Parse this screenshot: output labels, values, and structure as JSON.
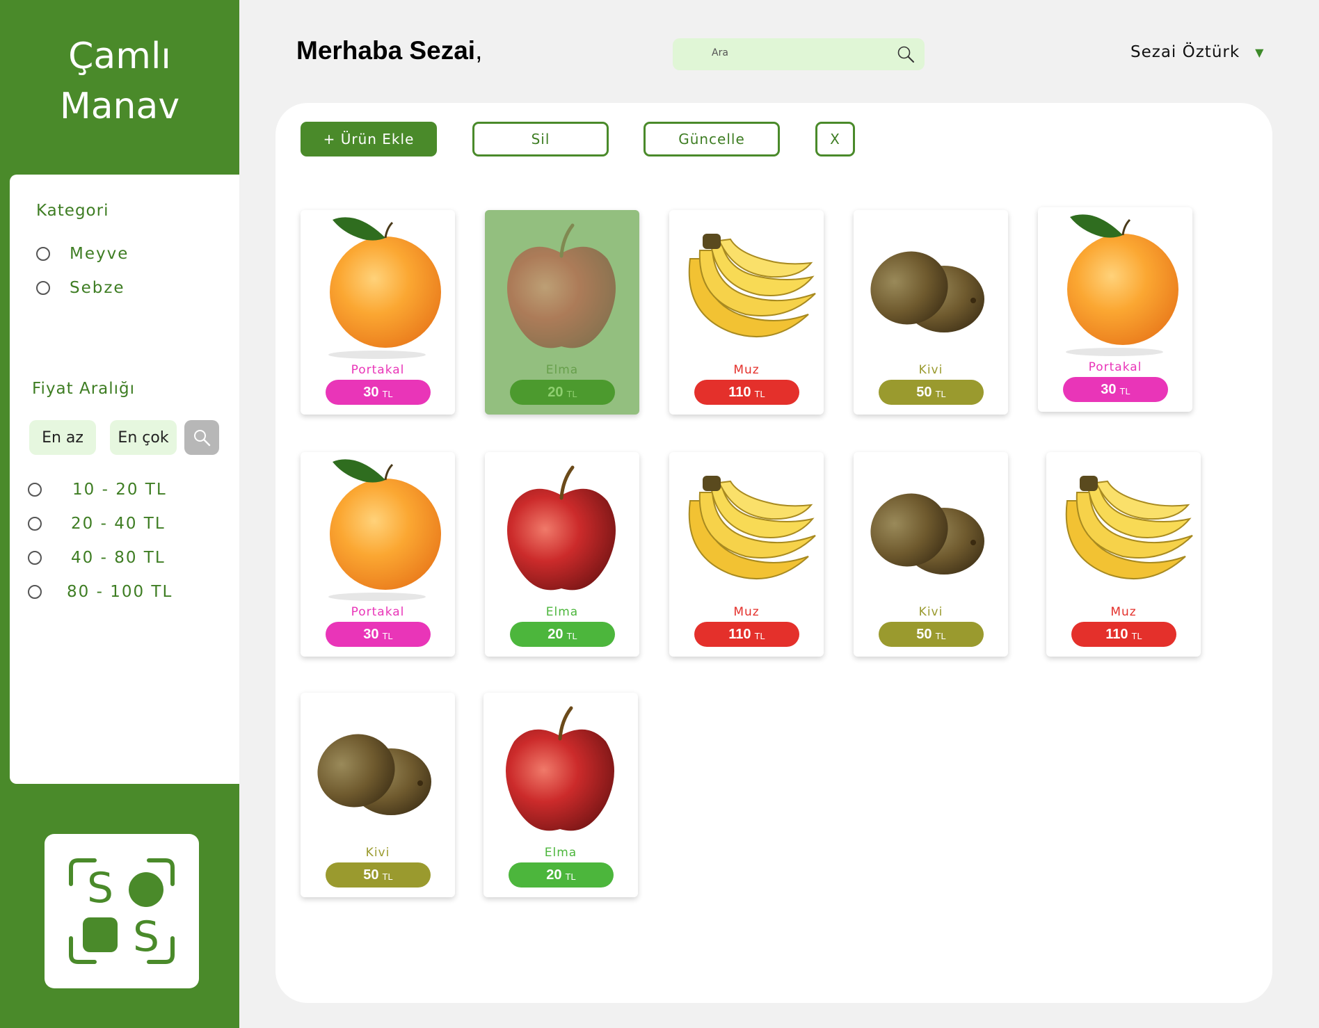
{
  "brand": {
    "line1": "Çamlı",
    "line2": "Manav"
  },
  "filters": {
    "category_title": "Kategori",
    "categories": [
      "Meyve",
      "Sebze"
    ],
    "price_title": "Fiyat Aralığı",
    "min_placeholder": "En az",
    "max_placeholder": "En çok",
    "ranges": [
      "10 - 20 TL",
      "20 - 40 TL",
      "40 - 80 TL",
      "80 - 100 TL"
    ]
  },
  "header": {
    "greeting_name": "Merhaba Sezai",
    "greeting_punct": ",",
    "search_placeholder": "Ara",
    "user_name": "Sezai Öztürk"
  },
  "toolbar": {
    "add_label": "+ Ürün Ekle",
    "delete_label": "Sil",
    "update_label": "Güncelle",
    "close_label": "X"
  },
  "currency": "TL",
  "colors": {
    "brand_green": "#4a8a2a",
    "portakal": "#e935b8",
    "elma": "#4cb63c",
    "muz": "#e4302b",
    "kivi": "#9a9a2e"
  },
  "products": [
    {
      "name": "Portakal",
      "price": "30",
      "fruit": "orange",
      "selected": false
    },
    {
      "name": "Elma",
      "price": "20",
      "fruit": "apple",
      "selected": true
    },
    {
      "name": "Muz",
      "price": "110",
      "fruit": "banana",
      "selected": false
    },
    {
      "name": "Kivi",
      "price": "50",
      "fruit": "kiwi",
      "selected": false
    },
    {
      "name": "Portakal",
      "price": "30",
      "fruit": "orange",
      "selected": false
    },
    {
      "name": "Portakal",
      "price": "30",
      "fruit": "orange",
      "selected": false
    },
    {
      "name": "Elma",
      "price": "20",
      "fruit": "apple",
      "selected": false
    },
    {
      "name": "Muz",
      "price": "110",
      "fruit": "banana",
      "selected": false
    },
    {
      "name": "Kivi",
      "price": "50",
      "fruit": "kiwi",
      "selected": false
    },
    {
      "name": "Muz",
      "price": "110",
      "fruit": "banana",
      "selected": false
    },
    {
      "name": "Kivi",
      "price": "50",
      "fruit": "kiwi",
      "selected": false
    },
    {
      "name": "Elma",
      "price": "20",
      "fruit": "apple",
      "selected": false
    }
  ]
}
